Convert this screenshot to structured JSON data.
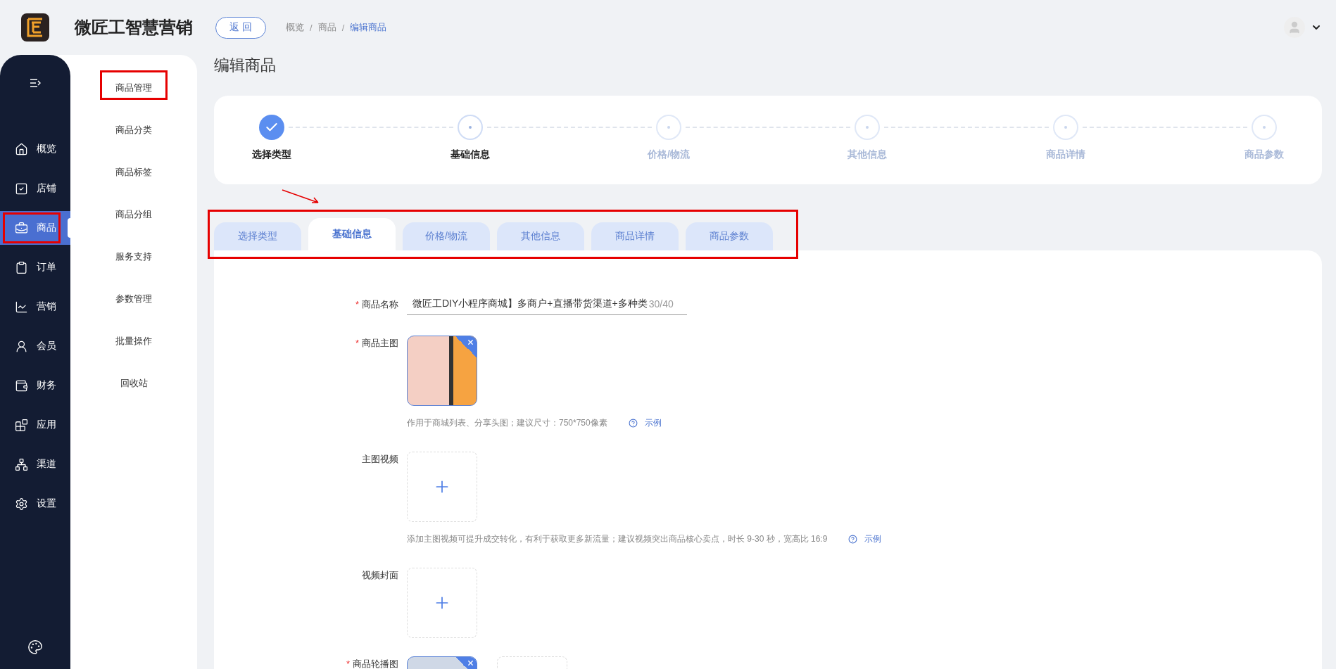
{
  "header": {
    "brand": "微匠工智慧营销",
    "back_button": "返 回",
    "breadcrumb_separator": "/",
    "breadcrumb": [
      {
        "label": "概览",
        "current": false
      },
      {
        "label": "商品",
        "current": false
      },
      {
        "label": "编辑商品",
        "current": true
      }
    ]
  },
  "nav": [
    {
      "label": "概览",
      "selected": false,
      "highlighted": false
    },
    {
      "label": "店铺",
      "selected": false,
      "highlighted": false
    },
    {
      "label": "商品",
      "selected": true,
      "highlighted": true
    },
    {
      "label": "订单",
      "selected": false,
      "highlighted": false
    },
    {
      "label": "营销",
      "selected": false,
      "highlighted": false
    },
    {
      "label": "会员",
      "selected": false,
      "highlighted": false
    },
    {
      "label": "财务",
      "selected": false,
      "highlighted": false
    },
    {
      "label": "应用",
      "selected": false,
      "highlighted": false
    },
    {
      "label": "渠道",
      "selected": false,
      "highlighted": false
    },
    {
      "label": "设置",
      "selected": false,
      "highlighted": false
    }
  ],
  "subnav": [
    {
      "label": "商品管理",
      "highlighted": true
    },
    {
      "label": "商品分类",
      "highlighted": false
    },
    {
      "label": "商品标签",
      "highlighted": false
    },
    {
      "label": "商品分组",
      "highlighted": false
    },
    {
      "label": "服务支持",
      "highlighted": false
    },
    {
      "label": "参数管理",
      "highlighted": false
    },
    {
      "label": "批量操作",
      "highlighted": false
    },
    {
      "label": "回收站",
      "highlighted": false
    }
  ],
  "page_title": "编辑商品",
  "steps": [
    {
      "label": "选择类型",
      "done": true,
      "selected": false
    },
    {
      "label": "基础信息",
      "done": false,
      "selected": true
    },
    {
      "label": "价格/物流",
      "done": false,
      "selected": false
    },
    {
      "label": "其他信息",
      "done": false,
      "selected": false
    },
    {
      "label": "商品详情",
      "done": false,
      "selected": false
    },
    {
      "label": "商品参数",
      "done": false,
      "selected": false
    }
  ],
  "tabs": {
    "highlighted": true,
    "arrow": true,
    "items": [
      {
        "label": "选择类型",
        "selected": false
      },
      {
        "label": "基础信息",
        "selected": true
      },
      {
        "label": "价格/物流",
        "selected": false
      },
      {
        "label": "其他信息",
        "selected": false
      },
      {
        "label": "商品详情",
        "selected": false
      },
      {
        "label": "商品参数",
        "selected": false
      }
    ]
  },
  "required_mark": "*",
  "form": [
    {
      "kind": "text",
      "label": "商品名称",
      "required": true,
      "value": "微匠工DIY小程序商城】多商户+直播带货渠道+多种类",
      "counter": "30/40"
    },
    {
      "kind": "image",
      "label": "商品主图",
      "required": true,
      "hint": "作用于商城列表、分享头图；建议尺寸：750*750像素",
      "help_link": "示例"
    },
    {
      "kind": "upload",
      "label": "主图视频",
      "required": false,
      "hint": "添加主图视频可提升成交转化，有利于获取更多新流量；建议视频突出商品核心卖点，时长 9-30 秒，宽高比 16:9",
      "help_link": "示例"
    },
    {
      "kind": "upload",
      "label": "视频封面",
      "required": false
    },
    {
      "kind": "gallery",
      "label": "商品轮播图",
      "required": true
    }
  ]
}
